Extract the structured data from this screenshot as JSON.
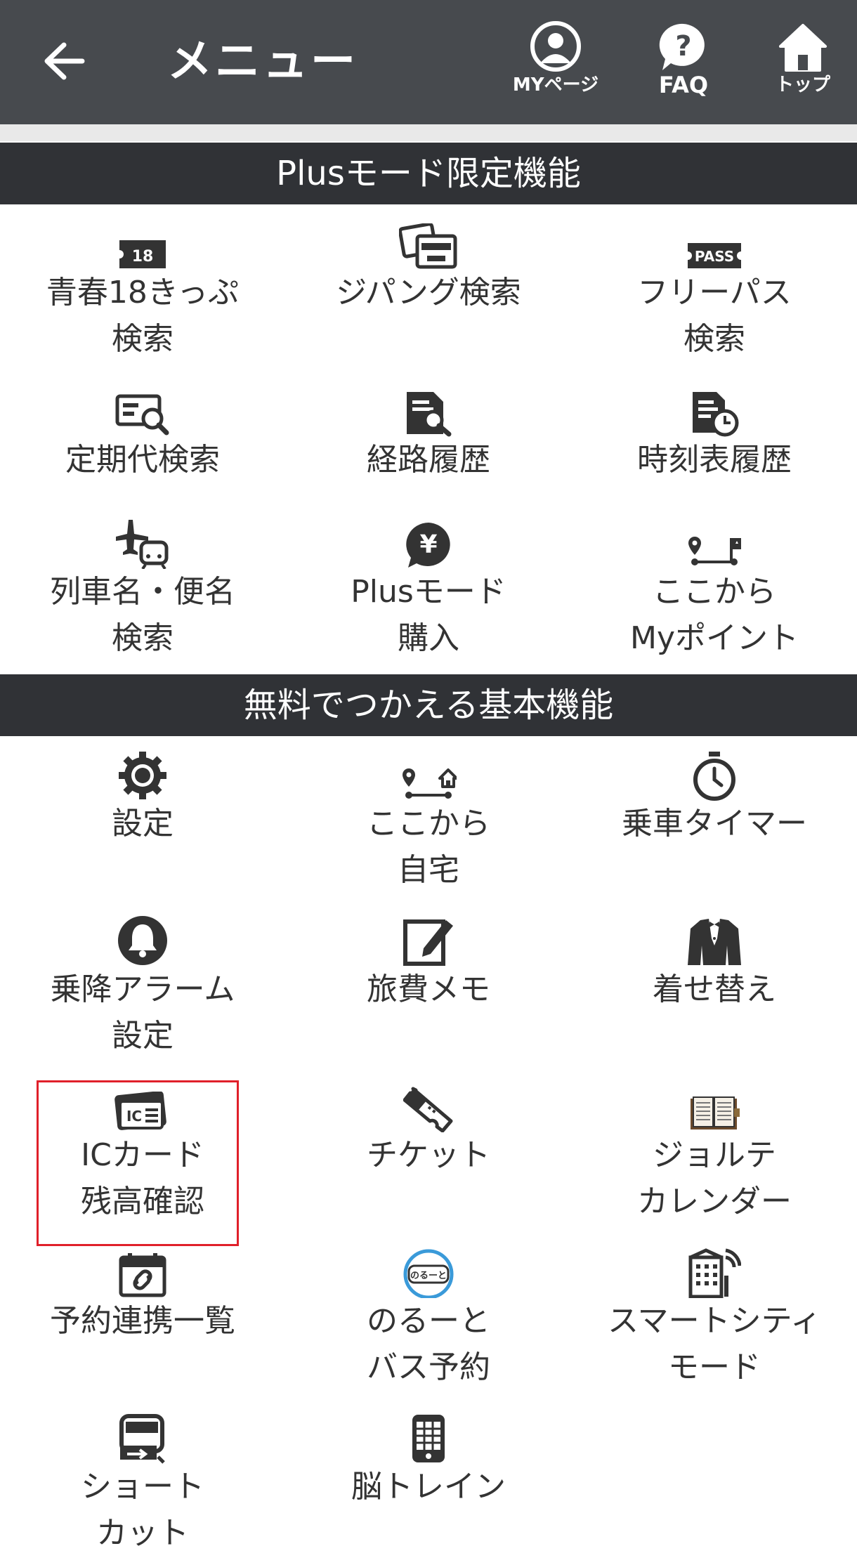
{
  "header": {
    "title": "メニュー",
    "mypage_label": "MYページ",
    "faq_label": "FAQ",
    "top_label": "トップ"
  },
  "colors": {
    "header_bg": "#474a4e",
    "section_bg": "#303236",
    "highlight": "#e0202a"
  },
  "plus_section": {
    "title": "Plusモード限定機能",
    "items": [
      {
        "label": "青春18きっぷ\n検索",
        "icon": "ticket-18-icon"
      },
      {
        "label": "ジパング検索",
        "icon": "zipang-cards-icon"
      },
      {
        "label": "フリーパス\n検索",
        "icon": "pass-ticket-icon"
      },
      {
        "label": "定期代検索",
        "icon": "commuter-pass-search-icon"
      },
      {
        "label": "経路履歴",
        "icon": "route-history-icon"
      },
      {
        "label": "時刻表履歴",
        "icon": "timetable-history-icon"
      },
      {
        "label": "列車名・便名\n検索",
        "icon": "plane-train-icon"
      },
      {
        "label": "Plusモード\n購入",
        "icon": "yen-purchase-icon"
      },
      {
        "label": "ここから\nMyポイント",
        "icon": "route-flag-icon"
      }
    ]
  },
  "free_section": {
    "title": "無料でつかえる基本機能",
    "items": [
      {
        "label": "設定",
        "icon": "gear-icon"
      },
      {
        "label": "ここから\n自宅",
        "icon": "route-home-icon"
      },
      {
        "label": "乗車タイマー",
        "icon": "stopwatch-icon"
      },
      {
        "label": "乗降アラーム\n設定",
        "icon": "bell-icon"
      },
      {
        "label": "旅費メモ",
        "icon": "memo-pencil-icon"
      },
      {
        "label": "着せ替え",
        "icon": "tuxedo-icon"
      },
      {
        "label": "ICカード\n残高確認",
        "icon": "ic-card-icon"
      },
      {
        "label": "チケット",
        "icon": "ticket-icon"
      },
      {
        "label": "ジョルテ\nカレンダー",
        "icon": "jorte-book-icon"
      },
      {
        "label": "予約連携一覧",
        "icon": "calendar-link-icon"
      },
      {
        "label": "のるーと\nバス予約",
        "icon": "noruto-logo",
        "logo_text": "のるーと"
      },
      {
        "label": "スマートシティ\nモード",
        "icon": "smart-city-icon"
      },
      {
        "label": "ショート\nカット",
        "icon": "shortcut-train-icon"
      },
      {
        "label": "脳トレイン",
        "icon": "calculator-icon"
      }
    ]
  }
}
